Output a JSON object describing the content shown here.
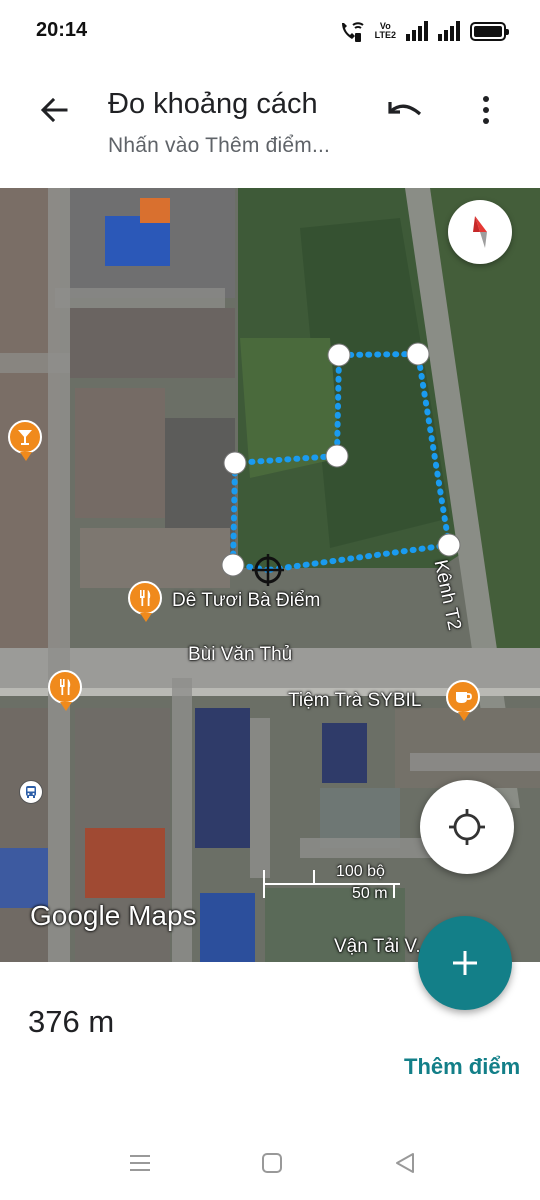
{
  "status_bar": {
    "time": "20:14",
    "network_label_top": "Vo",
    "network_label_bottom": "LTE2",
    "icons": [
      "wifi-calling-icon",
      "volte-icon",
      "signal-icon",
      "signal-icon",
      "battery-icon"
    ]
  },
  "app_bar": {
    "title": "Đo khoảng cách",
    "subtitle": "Nhấn vào Thêm điểm...",
    "back_icon": "arrow-back-icon",
    "undo_icon": "undo-icon",
    "menu_icon": "more-vert-icon"
  },
  "map": {
    "labels": {
      "restaurant_1": "Dê Tươi Bà Điểm",
      "street_main": "Bùi Văn Thủ",
      "cafe": "Tiệm Trà SYBIL",
      "canal": "Kênh T2",
      "bottom_place": "Vận Tải V... 17"
    },
    "scale": {
      "imperial": "100 bộ",
      "metric": "50 m"
    },
    "logo_text": "Google Maps",
    "measure_line_color": "#1a9bf0",
    "poi_color": "#f08a1c"
  },
  "measurement": {
    "distance": "376 m",
    "add_point_label": "Thêm điểm"
  },
  "colors": {
    "accent": "#137f88",
    "text_primary": "#202124",
    "text_secondary": "#5f6368"
  }
}
